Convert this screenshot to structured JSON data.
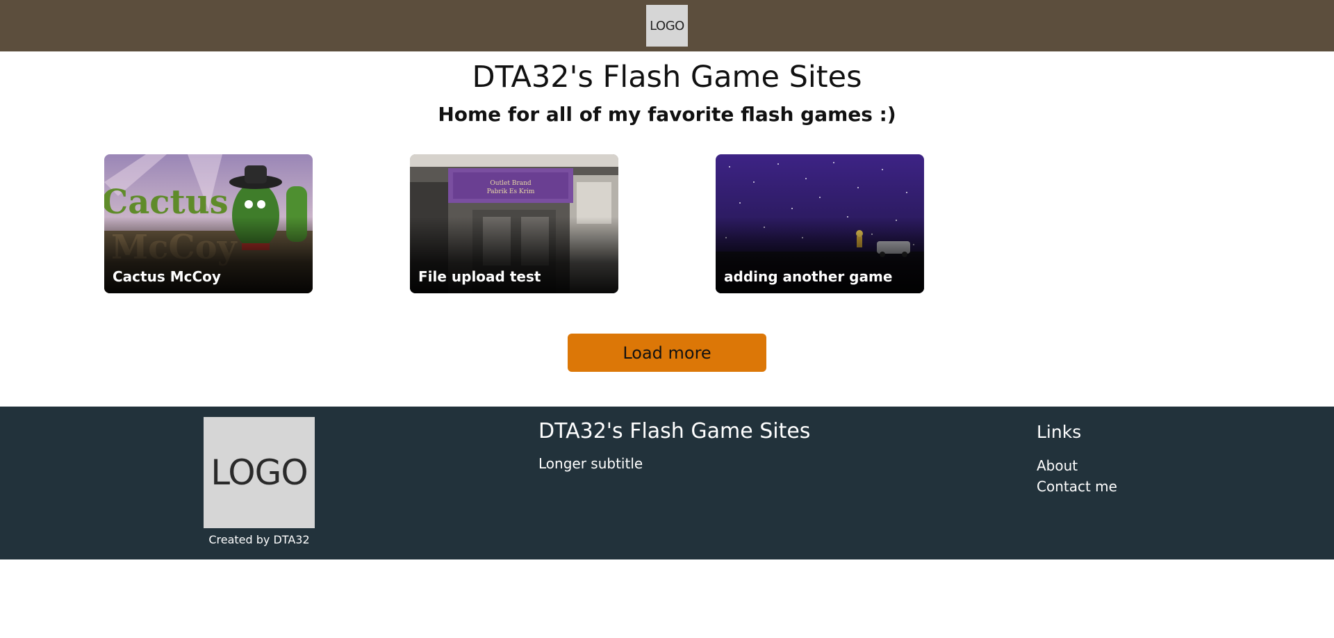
{
  "header": {
    "logo_text": "LOGO"
  },
  "main": {
    "title": "DTA32's Flash Game Sites",
    "subtitle": "Home for all of my favorite flash games :)",
    "games": [
      {
        "title": "Cactus McCoy"
      },
      {
        "title": "File upload test"
      },
      {
        "title": "adding another game"
      }
    ],
    "load_more_label": "Load more"
  },
  "footer": {
    "logo_text": "LOGO",
    "credit": "Created by DTA32",
    "title": "DTA32's Flash Game Sites",
    "subtitle": "Longer subtitle",
    "links_heading": "Links",
    "links": [
      {
        "label": "About"
      },
      {
        "label": "Contact me"
      }
    ]
  },
  "colors": {
    "header_bg": "#5c4e3d",
    "button_bg": "#dc7707",
    "footer_bg": "#22323b"
  }
}
